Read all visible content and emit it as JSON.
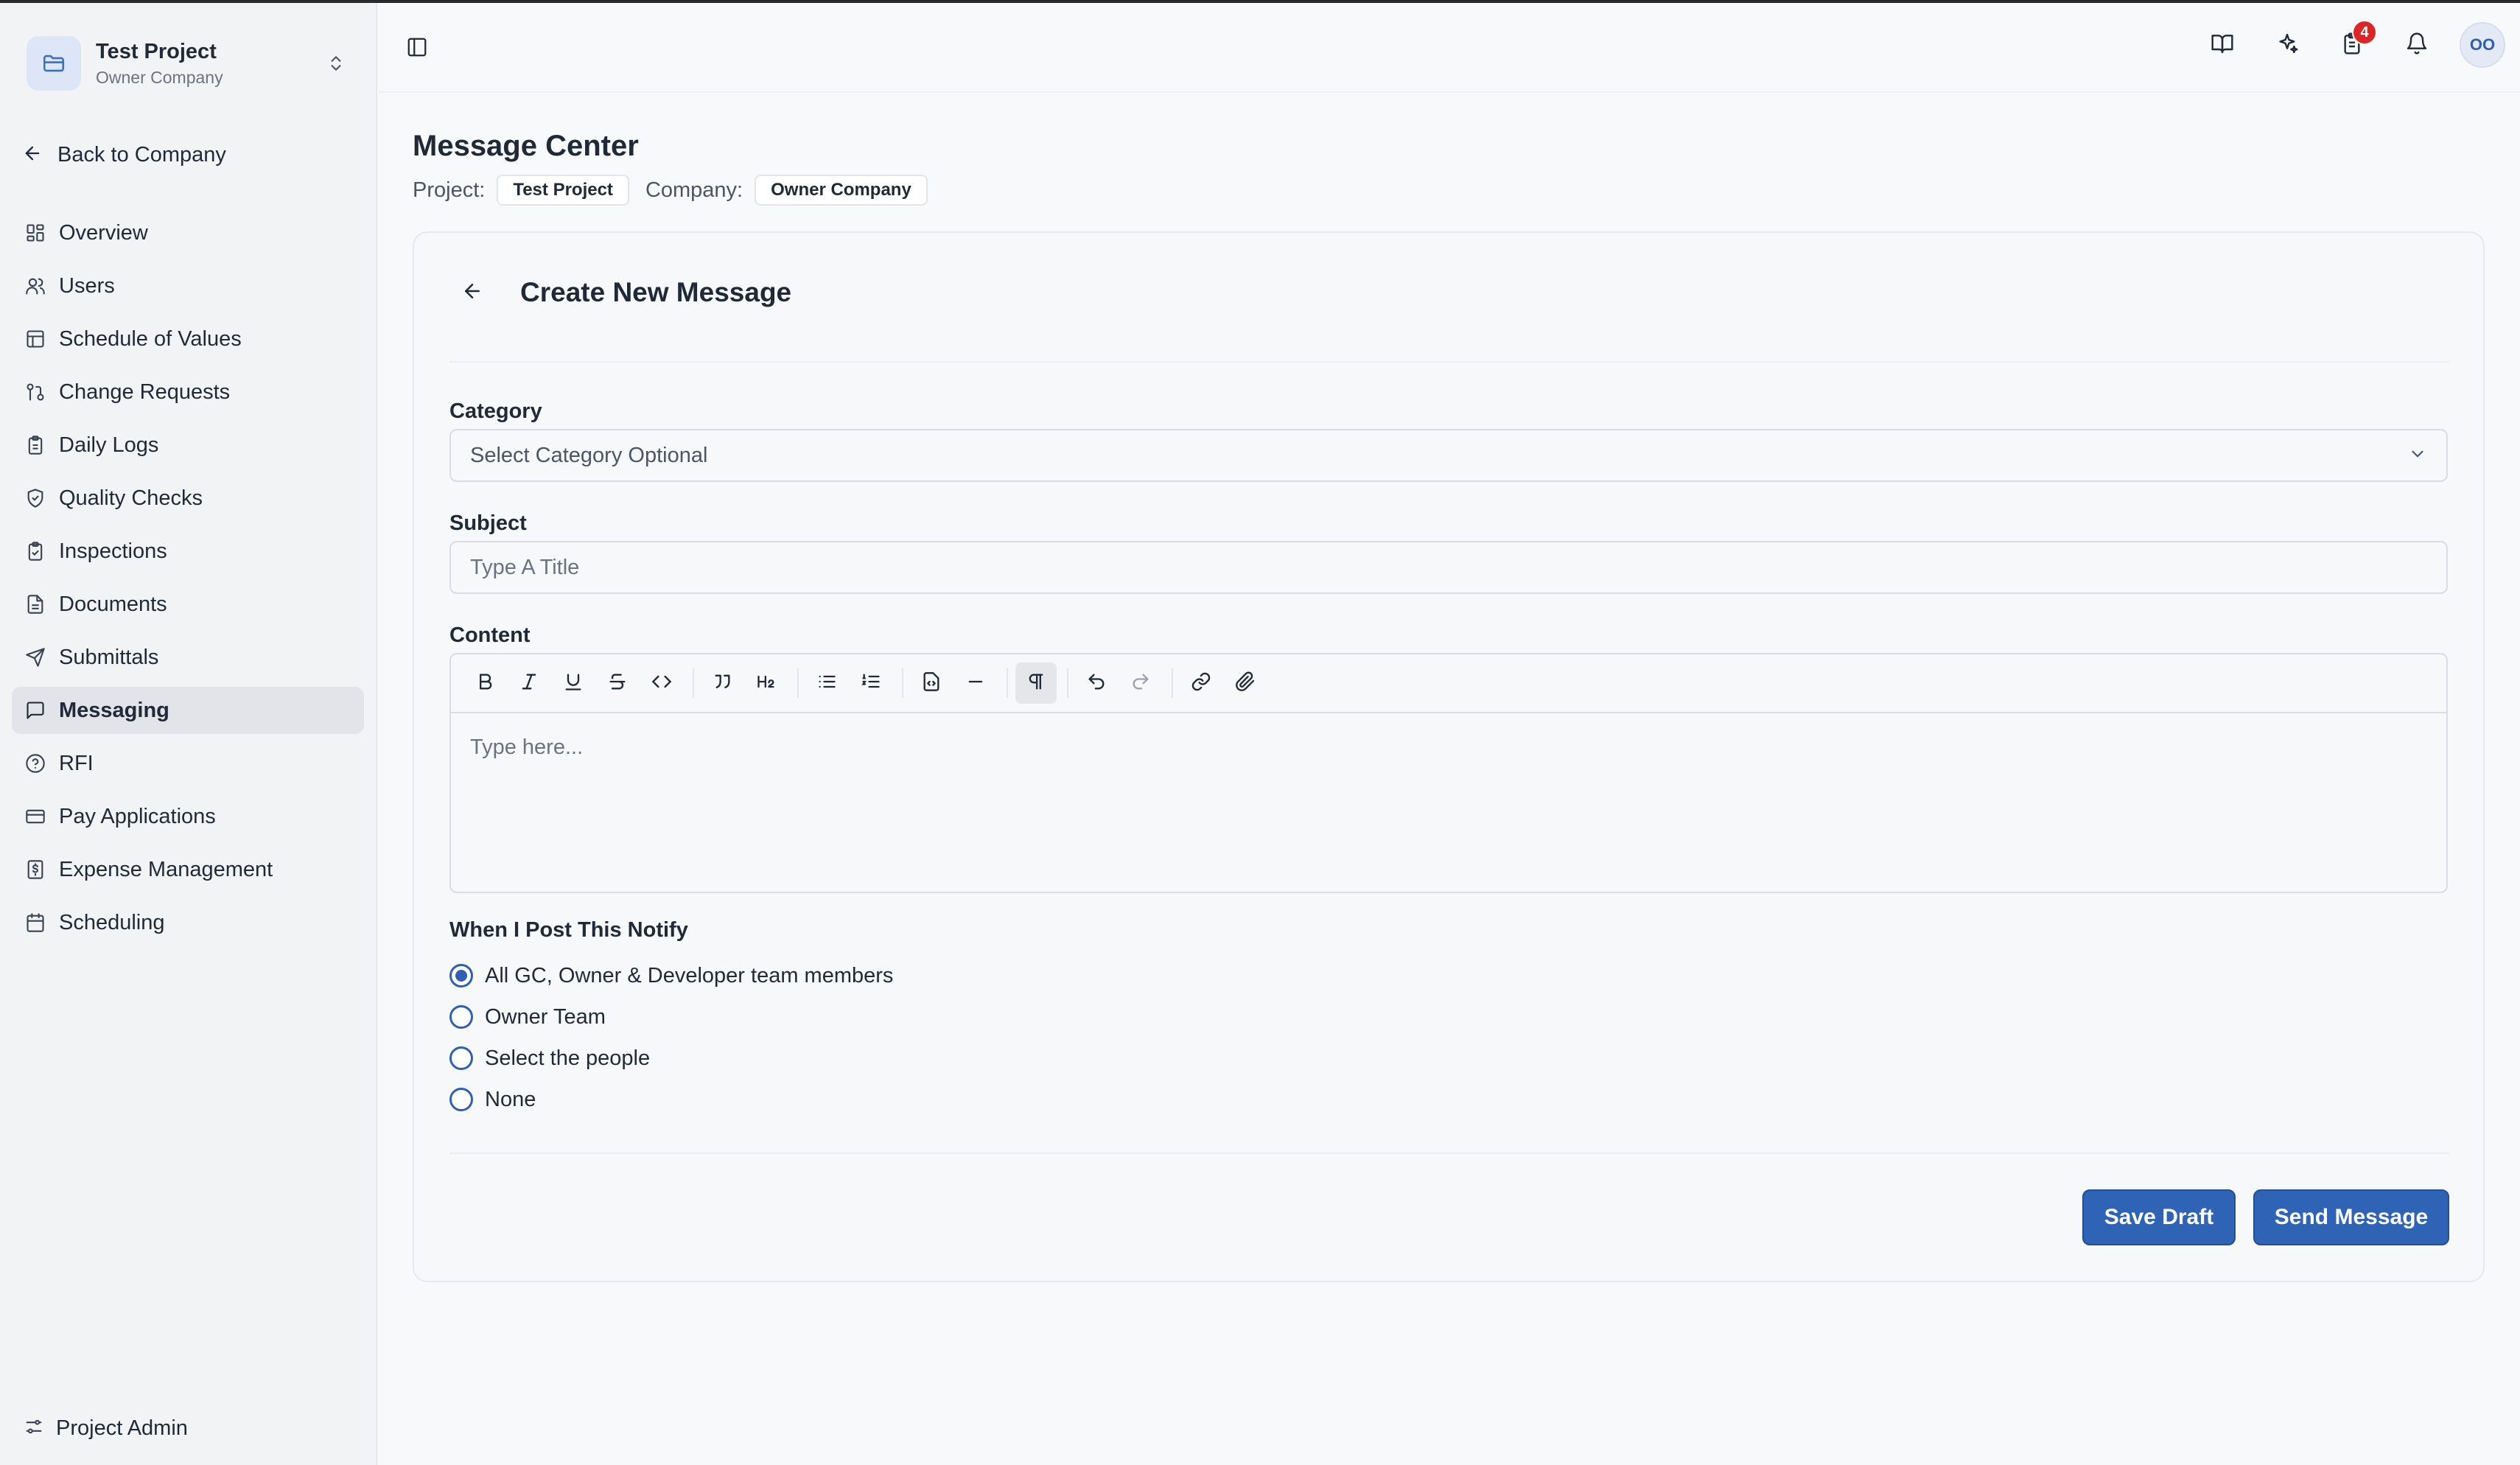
{
  "project": {
    "name": "Test Project",
    "company": "Owner Company"
  },
  "sidebar": {
    "back_label": "Back to Company",
    "items": [
      {
        "label": "Overview",
        "icon": "grid-icon",
        "active": false
      },
      {
        "label": "Users",
        "icon": "users-icon",
        "active": false
      },
      {
        "label": "Schedule of Values",
        "icon": "table-icon",
        "active": false
      },
      {
        "label": "Change Requests",
        "icon": "git-pull-icon",
        "active": false
      },
      {
        "label": "Daily Logs",
        "icon": "clipboard-icon",
        "active": false
      },
      {
        "label": "Quality Checks",
        "icon": "shield-check-icon",
        "active": false
      },
      {
        "label": "Inspections",
        "icon": "clipboard-check-icon",
        "active": false
      },
      {
        "label": "Documents",
        "icon": "document-icon",
        "active": false
      },
      {
        "label": "Submittals",
        "icon": "send-icon",
        "active": false
      },
      {
        "label": "Messaging",
        "icon": "message-icon",
        "active": true
      },
      {
        "label": "RFI",
        "icon": "help-circle-icon",
        "active": false
      },
      {
        "label": "Pay Applications",
        "icon": "credit-card-icon",
        "active": false
      },
      {
        "label": "Expense Management",
        "icon": "receipt-icon",
        "active": false
      },
      {
        "label": "Scheduling",
        "icon": "calendar-icon",
        "active": false
      }
    ],
    "footer_label": "Project Admin"
  },
  "topbar": {
    "notification_count": "4",
    "avatar_initials": "OO"
  },
  "page": {
    "title": "Message Center",
    "project_label": "Project:",
    "project_value": "Test Project",
    "company_label": "Company:",
    "company_value": "Owner Company"
  },
  "form": {
    "title": "Create New Message",
    "category_label": "Category",
    "category_value": "Select Category Optional",
    "subject_label": "Subject",
    "subject_placeholder": "Type A Title",
    "content_label": "Content",
    "content_placeholder": "Type here...",
    "notify_label": "When I Post This Notify",
    "notify_options": [
      {
        "label": "All GC, Owner & Developer team members",
        "selected": true
      },
      {
        "label": "Owner Team",
        "selected": false
      },
      {
        "label": "Select the people",
        "selected": false
      },
      {
        "label": "None",
        "selected": false
      }
    ],
    "save_draft_label": "Save Draft",
    "send_label": "Send Message"
  },
  "colors": {
    "accent": "#2f63b6",
    "badge": "#dc2626",
    "active_nav": "#e2e4e9"
  }
}
